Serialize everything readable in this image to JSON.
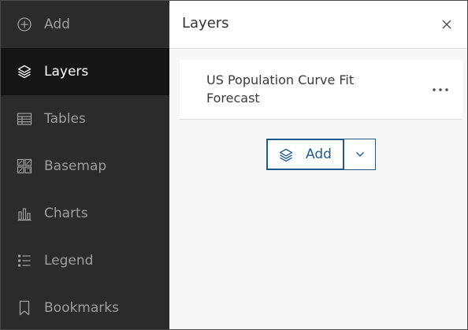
{
  "sidebar": {
    "items": [
      {
        "label": "Add",
        "icon": "plus-circle-icon",
        "active": false
      },
      {
        "label": "Layers",
        "icon": "layers-icon",
        "active": true
      },
      {
        "label": "Tables",
        "icon": "table-icon",
        "active": false
      },
      {
        "label": "Basemap",
        "icon": "basemap-icon",
        "active": false
      },
      {
        "label": "Charts",
        "icon": "bar-chart-icon",
        "active": false
      },
      {
        "label": "Legend",
        "icon": "legend-icon",
        "active": false
      },
      {
        "label": "Bookmarks",
        "icon": "bookmark-icon",
        "active": false
      }
    ]
  },
  "panel": {
    "title": "Layers",
    "layers": [
      {
        "title": "US Population Curve Fit Forecast"
      }
    ],
    "add_button_label": "Add"
  },
  "colors": {
    "sidebar_bg": "#2b2b2b",
    "sidebar_active_bg": "#151515",
    "accent": "#1e5a8e",
    "panel_bg": "#f7f7f7"
  }
}
